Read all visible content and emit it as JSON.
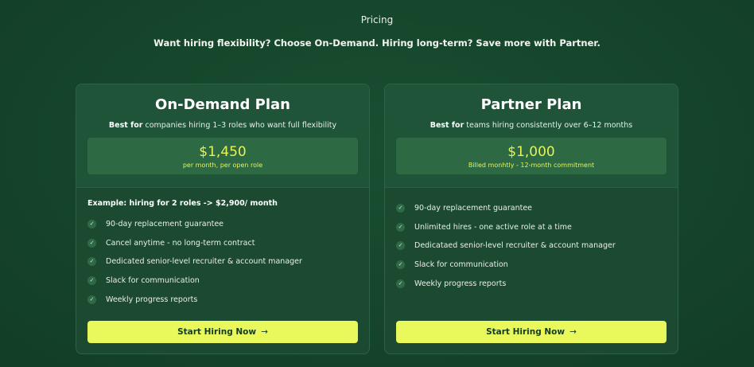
{
  "header": {
    "eyebrow": "Pricing",
    "subtitle": "Want hiring flexibility? Choose On-Demand. Hiring long-term? Save more with Partner."
  },
  "plans": [
    {
      "title": "On-Demand Plan",
      "best_for_label": "Best for",
      "best_for_text": " companies hiring 1–3 roles who want full flexibility",
      "price": "$1,450",
      "price_note": "per month, per open role",
      "example": "Example: hiring for 2 roles -> $2,900/ month",
      "features": [
        "90-day replacement guarantee",
        "Cancel anytime - no long-term contract",
        "Dedicated senior-level recruiter & account manager",
        "Slack for communication",
        "Weekly progress reports"
      ],
      "cta_label": "Start Hiring Now",
      "cta_arrow": "→"
    },
    {
      "title": "Partner Plan",
      "best_for_label": "Best for",
      "best_for_text": " teams hiring consistently over 6–12 months",
      "price": "$1,000",
      "price_note": "Billed monhtly - 12-month commitment",
      "features": [
        "90-day replacement guarantee",
        "Unlimited hires - one active role at a time",
        "Dedicataed senior-level recruiter & account manager",
        "Slack for communication",
        "Weekly progress reports"
      ],
      "cta_label": "Start Hiring Now",
      "cta_arrow": "→"
    }
  ],
  "icons": {
    "feature_check": "check-icon"
  },
  "colors": {
    "background": "#15452b",
    "accent": "#e9f85a",
    "price_text": "#e6f25a"
  }
}
